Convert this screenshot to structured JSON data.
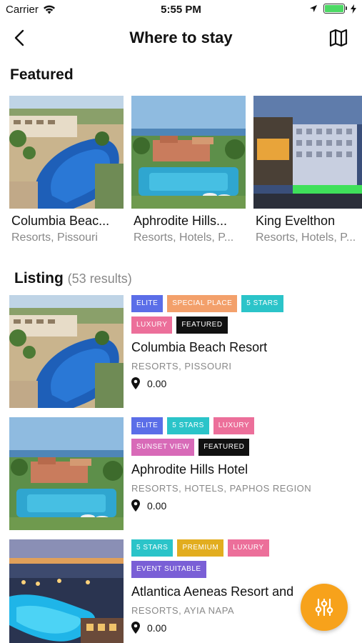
{
  "status_bar": {
    "carrier": "Carrier",
    "time": "5:55 PM"
  },
  "nav": {
    "title": "Where to stay"
  },
  "featured": {
    "heading": "Featured",
    "items": [
      {
        "title": "Columbia Beac...",
        "subtitle": "Resorts, Pissouri"
      },
      {
        "title": "Aphrodite Hills...",
        "subtitle": "Resorts, Hotels, P..."
      },
      {
        "title": "King Evelthon",
        "subtitle": "Resorts, Hotels, P..."
      }
    ]
  },
  "listing": {
    "heading": "Listing",
    "count": "(53 results)",
    "items": [
      {
        "title": "Columbia Beach Resort",
        "category": "RESORTS, PISSOURI",
        "location": "0.00",
        "tags": [
          {
            "label": "ELITE",
            "color": "#5b6ee8"
          },
          {
            "label": "SPECIAL PLACE",
            "color": "#f3a06b"
          },
          {
            "label": "5 STARS",
            "color": "#2bc4c9"
          },
          {
            "label": "LUXURY",
            "color": "#ec6f9a"
          },
          {
            "label": "FEATURED",
            "color": "#111111"
          }
        ]
      },
      {
        "title": "Aphrodite Hills Hotel",
        "category": "RESORTS, HOTELS, PAPHOS REGION",
        "location": "0.00",
        "tags": [
          {
            "label": "ELITE",
            "color": "#5b6ee8"
          },
          {
            "label": "5 STARS",
            "color": "#2bc4c9"
          },
          {
            "label": "LUXURY",
            "color": "#ec6f9a"
          },
          {
            "label": "SUNSET VIEW",
            "color": "#d86ab8"
          },
          {
            "label": "FEATURED",
            "color": "#111111"
          }
        ]
      },
      {
        "title": "Atlantica Aeneas Resort and",
        "category": "RESORTS, AYIA NAPA",
        "location": "0.00",
        "tags": [
          {
            "label": "5 STARS",
            "color": "#2bc4c9"
          },
          {
            "label": "PREMIUM",
            "color": "#e2ad1f"
          },
          {
            "label": "LUXURY",
            "color": "#ec6f9a"
          },
          {
            "label": "EVENT SUITABLE",
            "color": "#7a5fd6"
          }
        ]
      }
    ]
  },
  "fab": {
    "icon": "sliders-icon",
    "color": "#f7a21b"
  }
}
